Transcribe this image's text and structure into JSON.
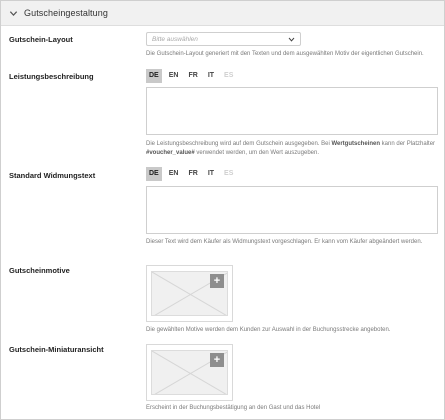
{
  "panel": {
    "title": "Gutscheingestaltung",
    "collapse_icon": "chevron-down-icon"
  },
  "layout": {
    "label": "Gutschein-Layout",
    "select_placeholder": "Bitte auswählen",
    "help": "Die Gutschein-Layout generiert mit den Texten und dem ausgewählten Motiv der eigentlichen Gutschein."
  },
  "description": {
    "label": "Leistungsbeschreibung",
    "languages": [
      {
        "code": "DE",
        "state": "active"
      },
      {
        "code": "EN",
        "state": "normal"
      },
      {
        "code": "FR",
        "state": "normal"
      },
      {
        "code": "IT",
        "state": "normal"
      },
      {
        "code": "ES",
        "state": "disabled"
      }
    ],
    "value": "",
    "help_part1": "Die Leistungsbeschreibung wird auf dem Gutschein ausgegeben. Bei ",
    "help_bold1": "Wertgutscheinen",
    "help_part2": " kann der Platzhalter ",
    "help_bold2": "#voucher_value#",
    "help_part3": " verwendet werden, um den Wert auszugeben."
  },
  "dedication": {
    "label": "Standard Widmungstext",
    "languages": [
      {
        "code": "DE",
        "state": "active"
      },
      {
        "code": "EN",
        "state": "normal"
      },
      {
        "code": "FR",
        "state": "normal"
      },
      {
        "code": "IT",
        "state": "normal"
      },
      {
        "code": "ES",
        "state": "disabled"
      }
    ],
    "value": "",
    "help": "Dieser Text wird dem Käufer als Widmungstext vorgeschlagen. Er kann vom Käufer abgeändert werden."
  },
  "motives": {
    "label": "Gutscheinmotive",
    "add_symbol": "+",
    "help": "Die gewählten Motive werden dem Kunden zur Auswahl in der Buchungsstrecke angeboten."
  },
  "thumbnail": {
    "label": "Gutschein-Miniaturansicht",
    "add_symbol": "+",
    "help": "Erscheint in der Buchungsbestätigung an den Gast und das Hotel"
  },
  "colors": {
    "header_bg": "#f1f1f1",
    "lang_active_bg": "#c9c9c9",
    "plus_bg": "#8e8e8e",
    "border": "#cfcfcf"
  }
}
